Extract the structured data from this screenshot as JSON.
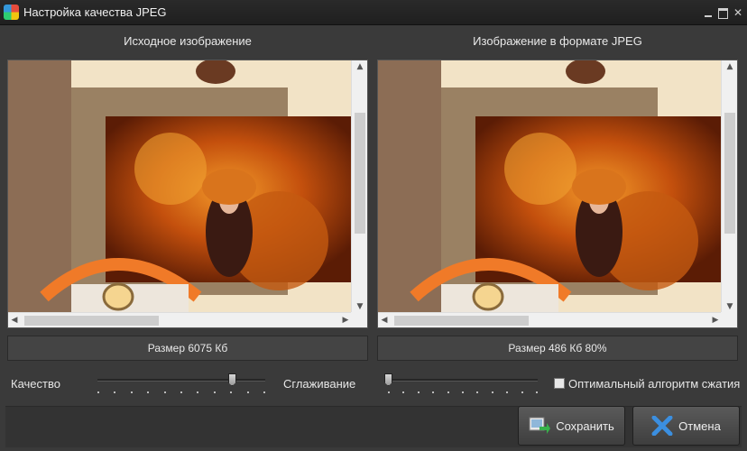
{
  "window": {
    "title": "Настройка качества JPEG"
  },
  "original_pane": {
    "title": "Исходное изображение",
    "size_text": "Размер 6075 Кб"
  },
  "jpeg_pane": {
    "title": "Изображение в формате JPEG",
    "size_text": "Размер 486 Кб 80%"
  },
  "controls": {
    "quality_label": "Качество",
    "quality_value": 0.8,
    "smoothing_label": "Сглаживание",
    "smoothing_value": 0,
    "optimal_algorithm_label": "Оптимальный алгоритм сжатия",
    "optimal_algorithm_checked": false
  },
  "buttons": {
    "save_label": "Сохранить",
    "cancel_label": "Отмена"
  },
  "icons": {
    "app": "app-logo-icon",
    "save": "save-image-icon",
    "cancel": "cancel-x-icon"
  },
  "colors": {
    "background": "#3a3a3a",
    "cancel_x": "#3b8fe0"
  }
}
